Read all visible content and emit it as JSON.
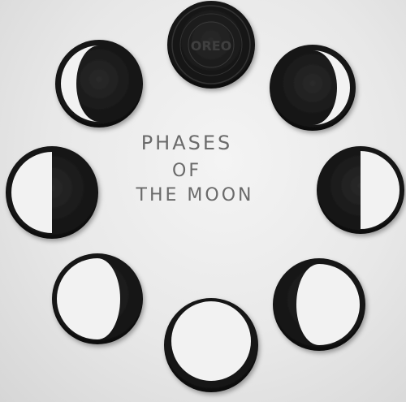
{
  "caption": {
    "line1": "PHASES",
    "line2": "OF",
    "line3": "THE MOON"
  },
  "cookie_stamp": "OREO",
  "colors": {
    "background": "#e9e9e9",
    "cookie": "#1a1a1a",
    "cream": "#f2f2f2",
    "text": "#6a6a6a"
  }
}
